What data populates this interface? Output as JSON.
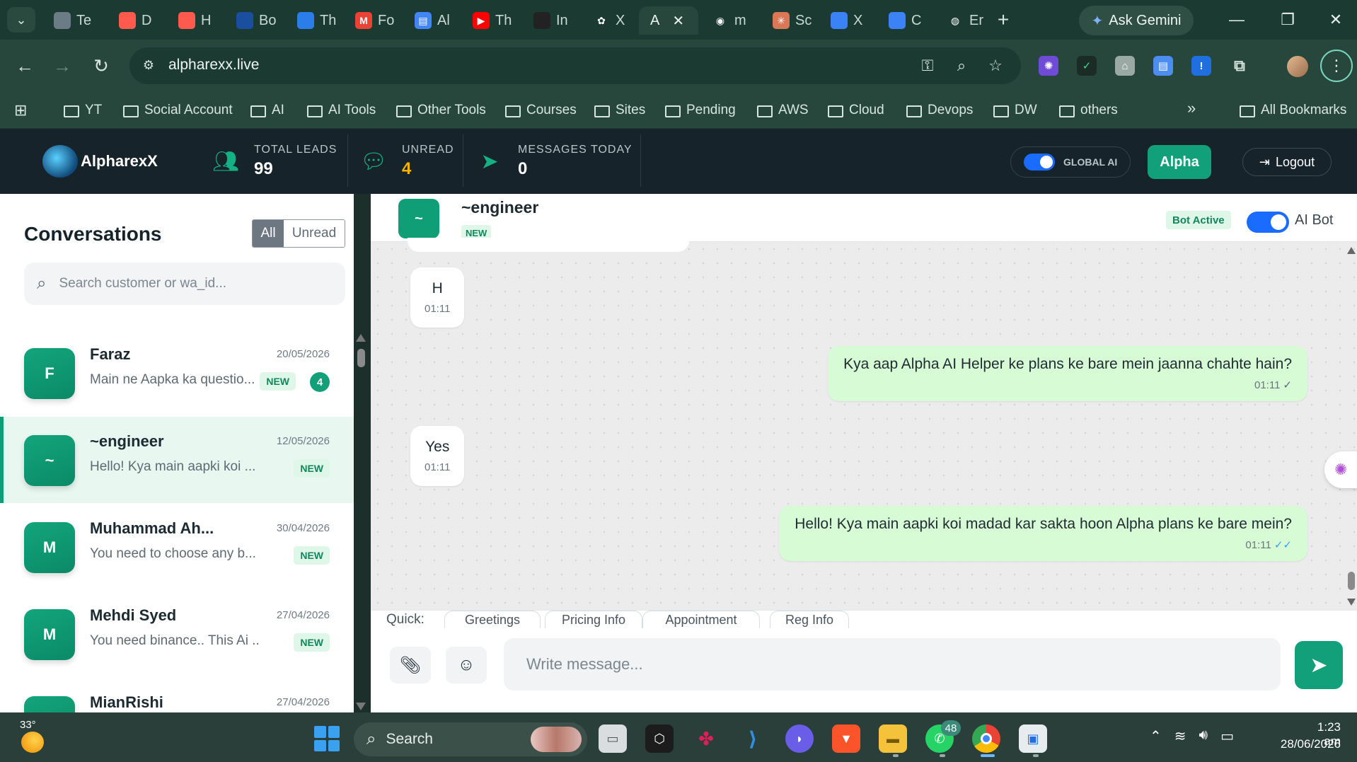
{
  "browser": {
    "tabs": [
      {
        "label": "Te",
        "icon": "tab-icon-1",
        "color": "#6b7c86"
      },
      {
        "label": "D",
        "icon": "tab-icon-2",
        "color": "#ff5a4d"
      },
      {
        "label": "H",
        "icon": "tab-icon-3",
        "color": "#ff5a4d"
      },
      {
        "label": "Bo",
        "icon": "tab-icon-4",
        "color": "#1a4fa0"
      },
      {
        "label": "Th",
        "icon": "tab-icon-5",
        "color": "#2b7de9"
      },
      {
        "label": "Fo",
        "icon": "gmail-icon",
        "color": "#ea4335"
      },
      {
        "label": "Al",
        "icon": "docs-icon",
        "color": "#4285f4"
      },
      {
        "label": "Th",
        "icon": "youtube-icon",
        "color": "#ff0000"
      },
      {
        "label": "In",
        "icon": "tab-icon-9",
        "color": "#222222"
      },
      {
        "label": "X",
        "icon": "openai-icon",
        "color": "#ffffff"
      },
      {
        "label": "A",
        "icon": "active-tab",
        "color": ""
      },
      {
        "label": "m",
        "icon": "github-icon",
        "color": "#ffffff"
      },
      {
        "label": "Sc",
        "icon": "claude-icon",
        "color": "#d97757"
      },
      {
        "label": "X",
        "icon": "tab-icon-14",
        "color": "#3b82f6"
      },
      {
        "label": "C",
        "icon": "tab-icon-15",
        "color": "#3b82f6"
      },
      {
        "label": "Er",
        "icon": "globe-icon",
        "color": "#9aa9a4"
      }
    ],
    "ask_gemini": "Ask Gemini",
    "url": "alpharexx.live",
    "bookmarks": [
      "YT",
      "Social Account",
      "AI",
      "AI Tools",
      "Other Tools",
      "Courses",
      "Sites",
      "Pending",
      "AWS",
      "Cloud",
      "Devops",
      "DW",
      "others"
    ],
    "all_bookmarks": "All Bookmarks"
  },
  "app": {
    "logo_text": "AlpharexX",
    "stats": [
      {
        "label": "TOTAL LEADS",
        "value": "99",
        "icon": "users-icon",
        "value_color": "#ffffff"
      },
      {
        "label": "UNREAD",
        "value": "4",
        "icon": "chat-bubble-icon",
        "value_color": "#f5b400"
      },
      {
        "label": "MESSAGES TODAY",
        "value": "0",
        "icon": "paper-plane-icon",
        "value_color": "#ffffff"
      }
    ],
    "global_ai_label": "GLOBAL AI",
    "alpha_button": "Alpha",
    "logout_button": "Logout",
    "accent_color": "#12a07a"
  },
  "sidebar": {
    "title": "Conversations",
    "filter_all": "All",
    "filter_unread": "Unread",
    "search_placeholder": "Search customer or wa_id...",
    "conversations": [
      {
        "initial": "F",
        "name": "Faraz",
        "date": "20/05/2026",
        "preview": "Main ne Aapka ka questio...",
        "badge": "NEW",
        "count": "4",
        "active": false
      },
      {
        "initial": "~",
        "name": "~engineer",
        "date": "12/05/2026",
        "preview": "Hello! Kya main aapki koi ...",
        "badge": "NEW",
        "count": "",
        "active": true
      },
      {
        "initial": "M",
        "name": "Muhammad Ah...",
        "date": "30/04/2026",
        "preview": "You need to choose any b...",
        "badge": "NEW",
        "count": "",
        "active": false
      },
      {
        "initial": "M",
        "name": "Mehdi Syed",
        "date": "27/04/2026",
        "preview": "You need binance.. This Ai ...",
        "badge": "NEW",
        "count": "",
        "active": false
      },
      {
        "initial": "",
        "name": "MianRishi",
        "date": "27/04/2026",
        "preview": "",
        "badge": "",
        "count": "",
        "active": false
      }
    ]
  },
  "chat": {
    "avatar_initial": "~",
    "name": "~engineer",
    "new_badge": "NEW",
    "bot_active": "Bot Active",
    "ai_bot_label": "AI Bot",
    "messages": [
      {
        "direction": "in",
        "text": "H",
        "time": "01:11",
        "tick": ""
      },
      {
        "direction": "out",
        "text": "Kya aap Alpha AI Helper ke plans ke bare mein jaanna chahte hain?",
        "time": "01:11",
        "tick": "✓"
      },
      {
        "direction": "in",
        "text": "Yes",
        "time": "01:11",
        "tick": ""
      },
      {
        "direction": "out",
        "text": "Hello! Kya main aapki koi madad kar sakta hoon Alpha plans ke bare mein?",
        "time": "01:11",
        "tick": "✓✓"
      }
    ],
    "quick_label": "Quick:",
    "quick_replies": [
      "Greetings",
      "Pricing Info",
      "Appointment",
      "Reg Info"
    ],
    "input_placeholder": "Write message..."
  },
  "taskbar": {
    "weather": "33°",
    "search_label": "Search",
    "whatsapp_badge": "48",
    "time": "1:23 am",
    "date": "28/06/2026"
  }
}
